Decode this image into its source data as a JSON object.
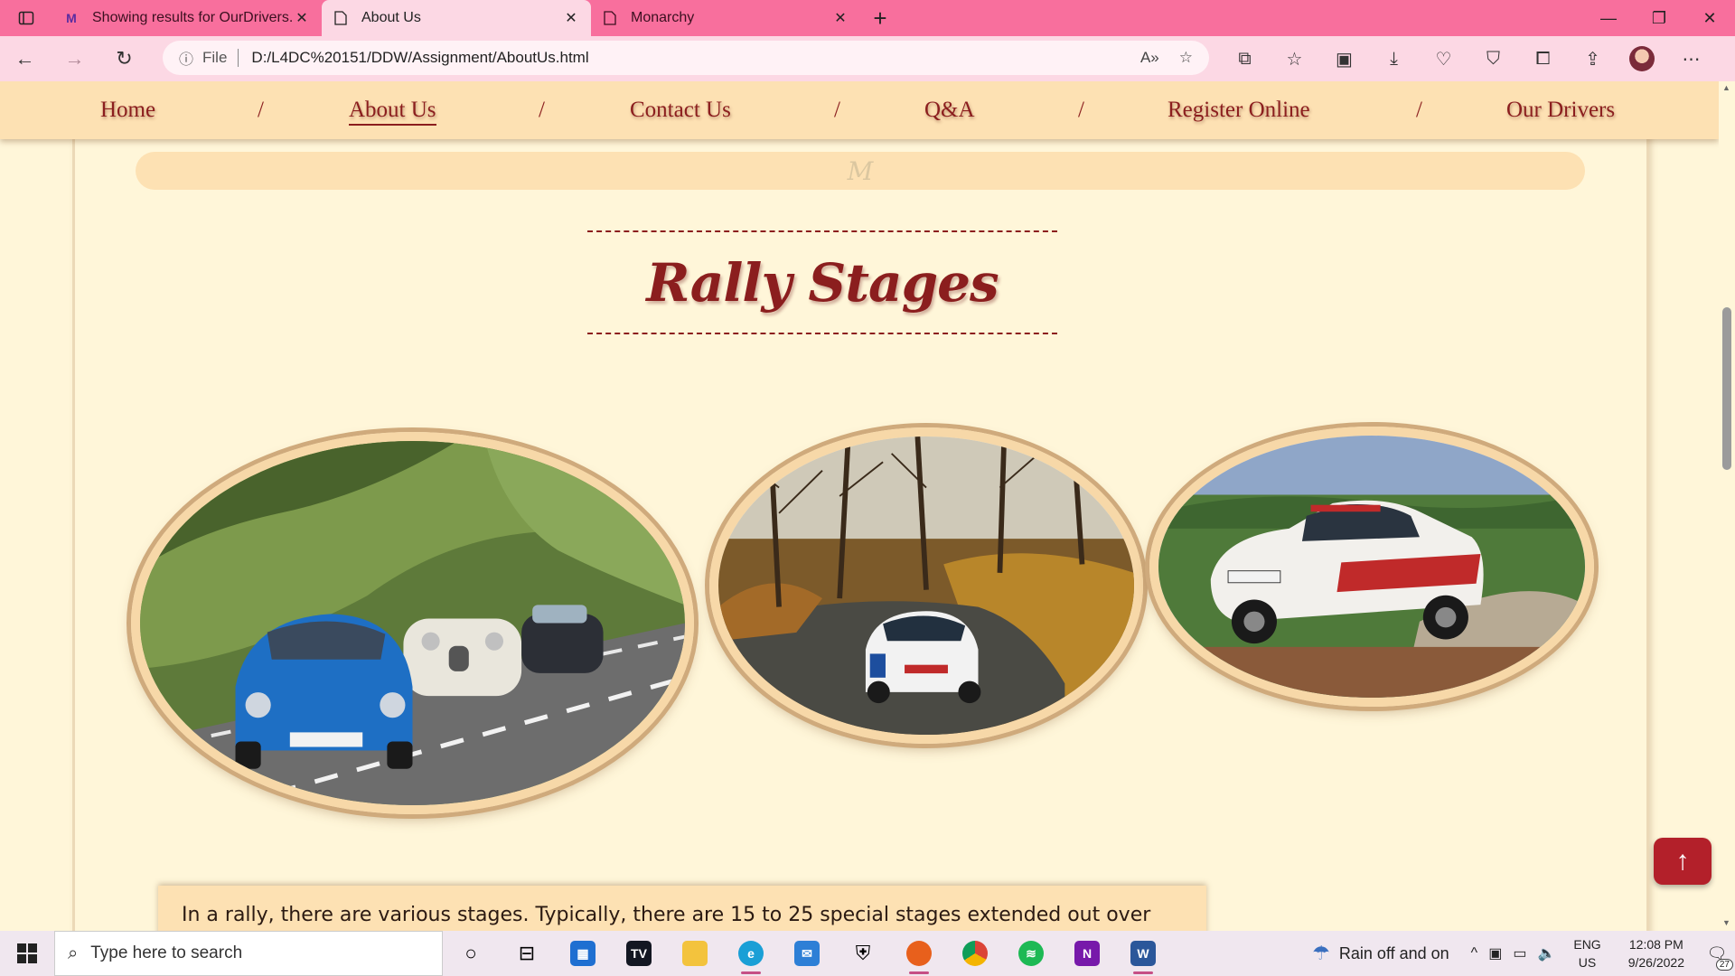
{
  "browser": {
    "tabs": [
      {
        "title": "Showing results for OurDrivers.h",
        "favicon": "vs-code-icon"
      },
      {
        "title": "About Us",
        "favicon": "page-icon"
      },
      {
        "title": "Monarchy",
        "favicon": "page-icon"
      }
    ],
    "address": {
      "scheme": "File",
      "url": "D:/L4DC%20151/DDW/Assignment/AboutUs.html"
    },
    "colors": {
      "tabbar": "#f86f9d",
      "toolbar": "#fcd8e4"
    }
  },
  "site": {
    "nav": [
      {
        "label": "Home",
        "current": false
      },
      {
        "label": "About Us",
        "current": true
      },
      {
        "label": "Contact Us",
        "current": false
      },
      {
        "label": "Q&A",
        "current": false
      },
      {
        "label": "Register Online",
        "current": false
      },
      {
        "label": "Our Drivers",
        "current": false
      }
    ],
    "separator": "/",
    "monogram": "M",
    "heading": "Rally Stages",
    "images": [
      {
        "name": "classic-cars-road-photo"
      },
      {
        "name": "rally-car-forest-photo"
      },
      {
        "name": "toyota-rally-car-jump-photo"
      }
    ],
    "paragraph": "In a rally, there are various stages. Typically, there are 15 to 25 special stages extended out over",
    "colors": {
      "accent": "#8b1e1e",
      "background": "#fff6d9",
      "nav": "#fde1b3",
      "top_button": "#b3202a"
    }
  },
  "taskbar": {
    "search_placeholder": "Type here to search",
    "weather": "Rain off and on",
    "language": [
      "ENG",
      "US"
    ],
    "time": "12:08 PM",
    "date": "9/26/2022",
    "notification_count": "27"
  }
}
